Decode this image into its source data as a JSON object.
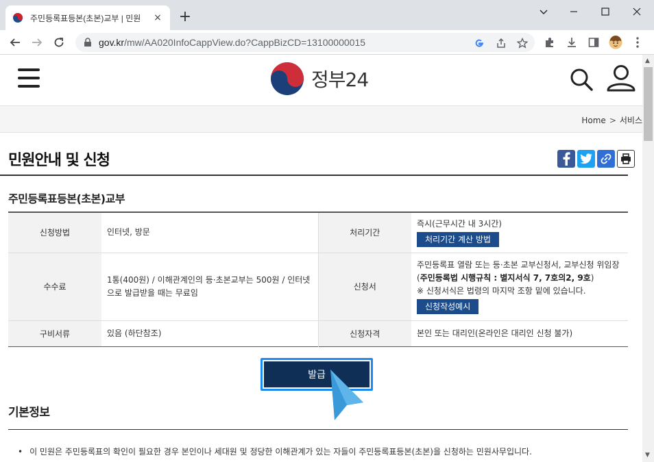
{
  "browser": {
    "tab_title": "주민등록표등본(초본)교부 | 민원",
    "tab_close": "×",
    "new_tab": "+",
    "url_host": "gov.kr",
    "url_path": "/mw/AA020InfoCappView.do?CappBizCD=13100000015"
  },
  "header": {
    "logo_text": "정부24"
  },
  "breadcrumb": {
    "home": "Home",
    "separator": ">",
    "current": "서비스"
  },
  "page": {
    "title": "민원안내 및 신청",
    "service_name": "주민등록표등본(초본)교부"
  },
  "info": {
    "rows": [
      {
        "left_label": "신청방법",
        "left_value": "인터넷, 방문",
        "right_label": "처리기간",
        "right_value": "즉시(근무시간 내 3시간)",
        "right_button": "처리기간 계산 방법"
      },
      {
        "left_label": "수수료",
        "left_value": "1통(400원) / 이해관계인의 등·초본교부는 500원 / 인터넷으로 발급받을 때는 무료임",
        "right_label": "신청서",
        "right_value_prefix": "주민등록표 열람 또는 등·초본 교부신청서, 교부신청 위임장 (",
        "right_value_bold": "주민등록법 시행규칙 : 별지서식 7, 7호의2, 9호",
        "right_value_suffix": ")",
        "right_note": "※ 신청서식은 법령의 마지막 조항 밑에 있습니다.",
        "right_button": "신청작성예시"
      },
      {
        "left_label": "구비서류",
        "left_value": "있음 (하단참조)",
        "right_label": "신청자격",
        "right_value": "본인 또는 대리인(온라인은 대리인 신청 불가)"
      }
    ]
  },
  "actions": {
    "issue_label": "발급"
  },
  "basic_info": {
    "title": "기본정보",
    "bullet": "이 민원은 주민등록표의 확인이 필요한 경우 본인이나 세대원 및 정당한 이해관계가 있는 자들이 주민등록표등본(초본)을 신청하는 민원사무입니다."
  },
  "colors": {
    "brand_blue": "#1c4c8c",
    "issue_button": "#0f2f57",
    "highlight": "#1a8bf0",
    "facebook": "#3b5998",
    "twitter": "#1da1f2",
    "link_share": "#2f6fd6"
  },
  "icons": [
    "back-icon",
    "forward-icon",
    "reload-icon",
    "lock-icon",
    "google-icon",
    "share-icon",
    "star-icon",
    "extensions-icon",
    "download-icon",
    "sidepanel-icon",
    "profile-avatar",
    "more-icon",
    "hamburger-icon",
    "search-icon",
    "user-icon",
    "facebook-icon",
    "twitter-icon",
    "link-icon",
    "print-icon",
    "cursor-arrow-icon"
  ]
}
